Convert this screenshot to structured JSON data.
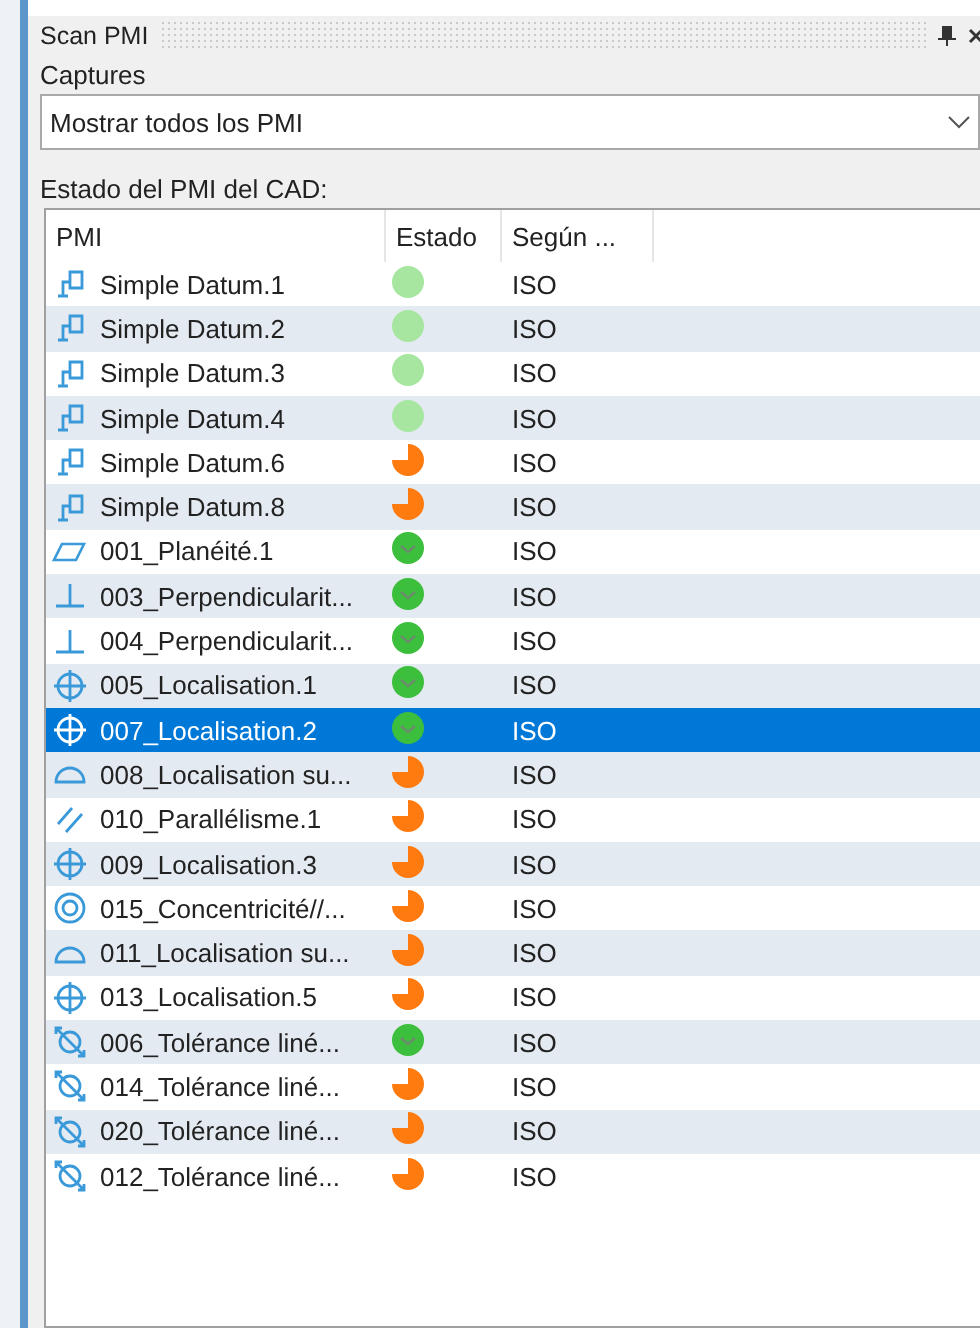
{
  "panel": {
    "title": "Scan PMI"
  },
  "captures": {
    "label": "Captures",
    "value": "Mostrar todos los PMI"
  },
  "status_group": {
    "label": "Estado del PMI del CAD:"
  },
  "table": {
    "columns": [
      "PMI",
      "Estado",
      "Según ..."
    ],
    "rows": [
      {
        "name": "Simple Datum.1",
        "icon": {
          "kind": "datum"
        },
        "status": {
          "kind": "pending"
        },
        "standard": "ISO",
        "selected": false
      },
      {
        "name": "Simple Datum.2",
        "icon": {
          "kind": "datum"
        },
        "status": {
          "kind": "pending"
        },
        "standard": "ISO",
        "selected": false
      },
      {
        "name": "Simple Datum.3",
        "icon": {
          "kind": "datum"
        },
        "status": {
          "kind": "pending"
        },
        "standard": "ISO",
        "selected": false
      },
      {
        "name": "Simple Datum.4",
        "icon": {
          "kind": "datum"
        },
        "status": {
          "kind": "pending"
        },
        "standard": "ISO",
        "selected": false
      },
      {
        "name": "Simple Datum.6",
        "icon": {
          "kind": "datum"
        },
        "status": {
          "kind": "partial"
        },
        "standard": "ISO",
        "selected": false
      },
      {
        "name": "Simple Datum.8",
        "icon": {
          "kind": "datum"
        },
        "status": {
          "kind": "partial"
        },
        "standard": "ISO",
        "selected": false
      },
      {
        "name": "001_Planéité.1",
        "icon": {
          "kind": "flatness"
        },
        "status": {
          "kind": "ok"
        },
        "standard": "ISO",
        "selected": false
      },
      {
        "name": "003_Perpendicularit...",
        "icon": {
          "kind": "perpendicularity"
        },
        "status": {
          "kind": "ok"
        },
        "standard": "ISO",
        "selected": false
      },
      {
        "name": "004_Perpendicularit...",
        "icon": {
          "kind": "perpendicularity"
        },
        "status": {
          "kind": "ok"
        },
        "standard": "ISO",
        "selected": false
      },
      {
        "name": "005_Localisation.1",
        "icon": {
          "kind": "position"
        },
        "status": {
          "kind": "ok"
        },
        "standard": "ISO",
        "selected": false
      },
      {
        "name": "007_Localisation.2",
        "icon": {
          "kind": "position"
        },
        "status": {
          "kind": "ok"
        },
        "standard": "ISO",
        "selected": true
      },
      {
        "name": "008_Localisation su...",
        "icon": {
          "kind": "profile"
        },
        "status": {
          "kind": "partial"
        },
        "standard": "ISO",
        "selected": false
      },
      {
        "name": "010_Parallélisme.1",
        "icon": {
          "kind": "parallelism"
        },
        "status": {
          "kind": "partial"
        },
        "standard": "ISO",
        "selected": false
      },
      {
        "name": "009_Localisation.3",
        "icon": {
          "kind": "position"
        },
        "status": {
          "kind": "partial"
        },
        "standard": "ISO",
        "selected": false
      },
      {
        "name": "015_Concentricité//...",
        "icon": {
          "kind": "concentricity"
        },
        "status": {
          "kind": "partial"
        },
        "standard": "ISO",
        "selected": false
      },
      {
        "name": "011_Localisation su...",
        "icon": {
          "kind": "profile"
        },
        "status": {
          "kind": "partial"
        },
        "standard": "ISO",
        "selected": false
      },
      {
        "name": "013_Localisation.5",
        "icon": {
          "kind": "position"
        },
        "status": {
          "kind": "partial"
        },
        "standard": "ISO",
        "selected": false
      },
      {
        "name": "006_Tolérance liné...",
        "icon": {
          "kind": "linear"
        },
        "status": {
          "kind": "ok"
        },
        "standard": "ISO",
        "selected": false
      },
      {
        "name": "014_Tolérance liné...",
        "icon": {
          "kind": "linear"
        },
        "status": {
          "kind": "partial"
        },
        "standard": "ISO",
        "selected": false
      },
      {
        "name": "020_Tolérance liné...",
        "icon": {
          "kind": "linear"
        },
        "status": {
          "kind": "partial"
        },
        "standard": "ISO",
        "selected": false
      },
      {
        "name": "012_Tolérance liné...",
        "icon": {
          "kind": "linear"
        },
        "status": {
          "kind": "partial"
        },
        "standard": "ISO",
        "selected": false
      }
    ]
  }
}
